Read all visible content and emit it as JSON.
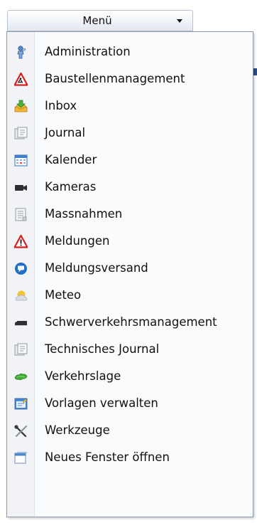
{
  "menu": {
    "button_label": "Menü"
  },
  "items": [
    {
      "label": "Administration",
      "icon": "administration-icon"
    },
    {
      "label": "Baustellenmanagement",
      "icon": "construction-warning-icon"
    },
    {
      "label": "Inbox",
      "icon": "inbox-icon"
    },
    {
      "label": "Journal",
      "icon": "journal-icon"
    },
    {
      "label": "Kalender",
      "icon": "calendar-icon"
    },
    {
      "label": "Kameras",
      "icon": "camera-icon"
    },
    {
      "label": "Massnahmen",
      "icon": "measures-document-icon"
    },
    {
      "label": "Meldungen",
      "icon": "warning-triangle-icon"
    },
    {
      "label": "Meldungsversand",
      "icon": "message-bubble-icon"
    },
    {
      "label": "Meteo",
      "icon": "weather-icon"
    },
    {
      "label": "Schwerverkehrsmanagement",
      "icon": "truck-icon"
    },
    {
      "label": "Technisches Journal",
      "icon": "technical-journal-icon"
    },
    {
      "label": "Verkehrslage",
      "icon": "traffic-map-icon"
    },
    {
      "label": "Vorlagen verwalten",
      "icon": "templates-icon"
    },
    {
      "label": "Werkzeuge",
      "icon": "tools-icon"
    },
    {
      "label": "Neues Fenster öffnen",
      "icon": "new-window-icon"
    }
  ]
}
